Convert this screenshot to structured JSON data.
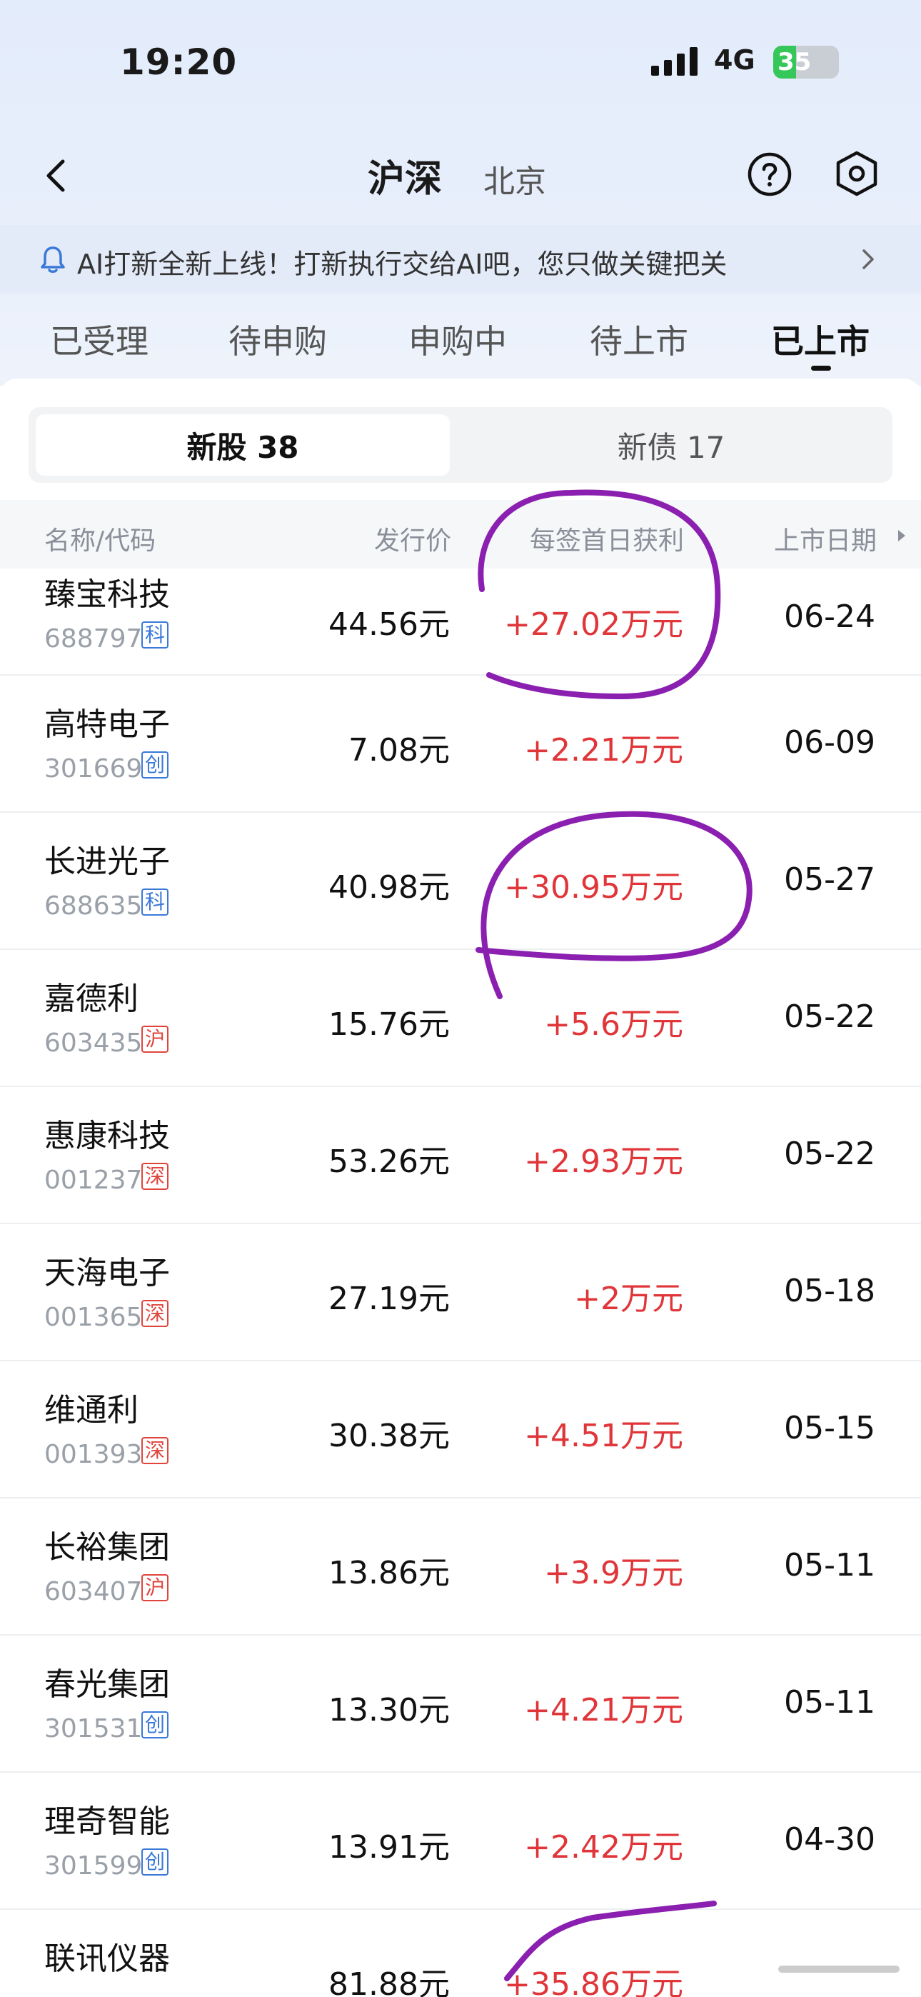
{
  "status": {
    "time": "19:20",
    "network": "4G",
    "battery": "35",
    "battery_level": 0.35
  },
  "nav": {
    "title": "沪深",
    "subtitle": "北京"
  },
  "banner": {
    "text": "AI打新全新上线！打新执行交给AI吧，您只做关键把关"
  },
  "tabs": [
    {
      "label": "已受理"
    },
    {
      "label": "待申购"
    },
    {
      "label": "申购中"
    },
    {
      "label": "待上市"
    },
    {
      "label": "已上市"
    }
  ],
  "segment": {
    "left": "新股 38",
    "right": "新债 17"
  },
  "table": {
    "headers": {
      "name": "名称/代码",
      "price": "发行价",
      "profit": "每签首日获利",
      "date": "上市日期"
    },
    "rows": [
      {
        "name": "臻宝科技",
        "code": "688797",
        "board": "科",
        "board_color": "blue",
        "price": "44.56元",
        "profit": "+27.02万元",
        "date": "06-24"
      },
      {
        "name": "高特电子",
        "code": "301669",
        "board": "创",
        "board_color": "blue",
        "price": "7.08元",
        "profit": "+2.21万元",
        "date": "06-09"
      },
      {
        "name": "长进光子",
        "code": "688635",
        "board": "科",
        "board_color": "blue",
        "price": "40.98元",
        "profit": "+30.95万元",
        "date": "05-27"
      },
      {
        "name": "嘉德利",
        "code": "603435",
        "board": "沪",
        "board_color": "red",
        "price": "15.76元",
        "profit": "+5.6万元",
        "date": "05-22"
      },
      {
        "name": "惠康科技",
        "code": "001237",
        "board": "深",
        "board_color": "red",
        "price": "53.26元",
        "profit": "+2.93万元",
        "date": "05-22"
      },
      {
        "name": "天海电子",
        "code": "001365",
        "board": "深",
        "board_color": "red",
        "price": "27.19元",
        "profit": "+2万元",
        "date": "05-18"
      },
      {
        "name": "维通利",
        "code": "001393",
        "board": "深",
        "board_color": "red",
        "price": "30.38元",
        "profit": "+4.51万元",
        "date": "05-15"
      },
      {
        "name": "长裕集团",
        "code": "603407",
        "board": "沪",
        "board_color": "red",
        "price": "13.86元",
        "profit": "+3.9万元",
        "date": "05-11"
      },
      {
        "name": "春光集团",
        "code": "301531",
        "board": "创",
        "board_color": "blue",
        "price": "13.30元",
        "profit": "+4.21万元",
        "date": "05-11"
      },
      {
        "name": "理奇智能",
        "code": "301599",
        "board": "创",
        "board_color": "blue",
        "price": "13.91元",
        "profit": "+2.42万元",
        "date": "04-30"
      },
      {
        "name": "联讯仪器",
        "code": "",
        "board": "",
        "board_color": "blue",
        "price": "81.88元",
        "profit": "+35.86万元",
        "date": ""
      }
    ]
  },
  "colors": {
    "profit": "#e0363a",
    "annotation": "#8a1fb0",
    "accent_blue": "#3a79d8"
  }
}
